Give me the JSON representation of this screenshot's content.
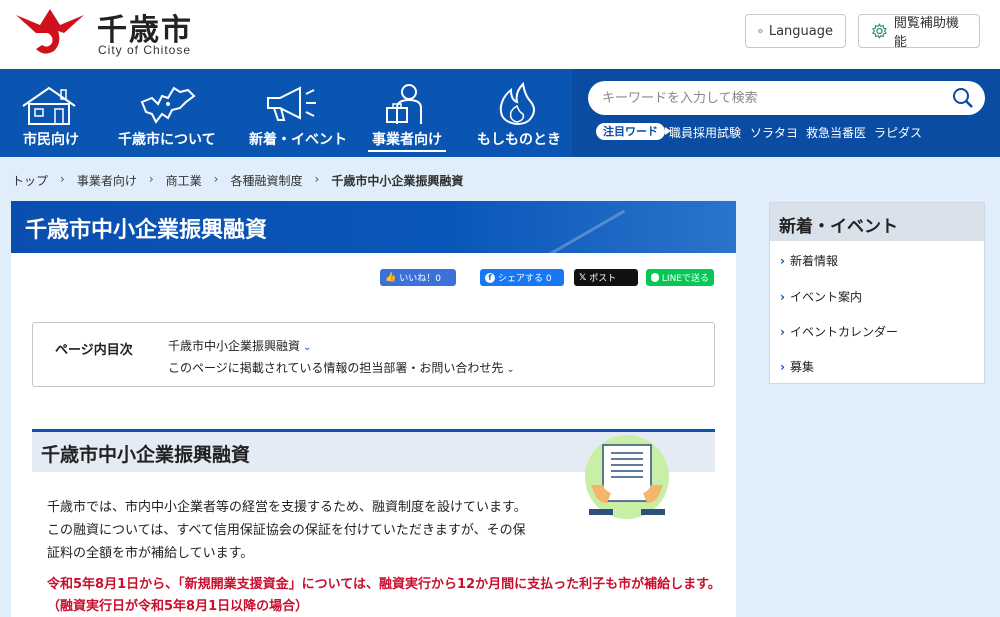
{
  "header": {
    "logo_title": "千歳市",
    "logo_subtitle": "City of Chitose",
    "language_label": "Language",
    "accessibility_label": "閲覧補助機能",
    "brand_color": "#0a55b2",
    "logo_color": "#d0101d"
  },
  "nav": {
    "items": [
      {
        "label": "市民向け",
        "icon": "house-icon"
      },
      {
        "label": "千歳市について",
        "icon": "hokkaido-map-icon"
      },
      {
        "label": "新着・イベント",
        "icon": "megaphone-icon"
      },
      {
        "label": "事業者向け",
        "icon": "businessperson-icon"
      },
      {
        "label": "もしものとき",
        "icon": "fire-icon"
      }
    ],
    "active_index": 3
  },
  "search": {
    "placeholder": "キーワードを入力して検索",
    "keywords_badge": "注目ワード",
    "keywords": [
      "職員採用試験",
      "ソラタヨ",
      "救急当番医",
      "ラピダス"
    ]
  },
  "breadcrumb": [
    "トップ",
    "事業者向け",
    "商工業",
    "各種融資制度",
    "千歳市中小企業振興融資"
  ],
  "page": {
    "title": "千歳市中小企業振興融資",
    "share": {
      "like": "いいね！0",
      "fb_share": "シェアする 0",
      "x_post": "ポスト",
      "line": "LINEで送る"
    },
    "toc": {
      "label": "ページ内目次",
      "links": [
        "千歳市中小企業振興融資",
        "このページに掲載されている情報の担当部署・お問い合わせ先"
      ]
    },
    "section_title": "千歳市中小企業振興融資",
    "paragraphs": [
      "千歳市では、市内中小企業者等の経営を支援するため、融資制度を設けています。",
      "この融資については、すべて信用保証協会の保証を付けていただきますが、その保",
      "証料の全額を市が補給しています。"
    ],
    "notice": [
      "令和5年8月1日から、「新規開業支援資金」については、融資実行から12か月間に支払った利子も市が補給します。",
      "（融資実行日が令和5年8月1日以降の場合）"
    ],
    "notice_color": "#c8102e"
  },
  "sidebar": {
    "title": "新着・イベント",
    "items": [
      "新着情報",
      "イベント案内",
      "イベントカレンダー",
      "募集"
    ]
  }
}
